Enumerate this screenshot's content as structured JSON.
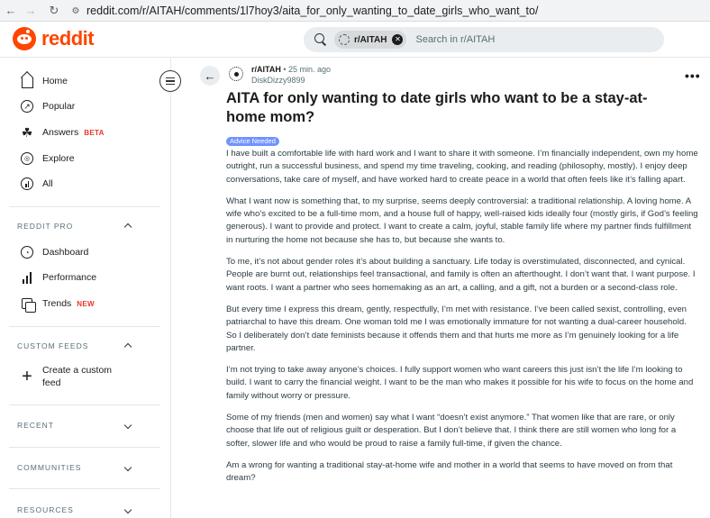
{
  "browser": {
    "url": "reddit.com/r/AITAH/comments/1l7hoy3/aita_for_only_wanting_to_date_girls_who_want_to/"
  },
  "header": {
    "logo_text": "reddit",
    "search": {
      "chip_label": "r/AITAH",
      "placeholder": "Search in r/AITAH"
    }
  },
  "sidebar": {
    "main_items": [
      {
        "label": "Home",
        "icon": "home-icon"
      },
      {
        "label": "Popular",
        "icon": "popular-icon"
      },
      {
        "label": "Answers",
        "badge": "BETA",
        "icon": "answers-icon"
      },
      {
        "label": "Explore",
        "icon": "explore-icon"
      },
      {
        "label": "All",
        "icon": "all-icon"
      }
    ],
    "reddit_pro": {
      "title": "REDDIT PRO",
      "items": [
        {
          "label": "Dashboard",
          "icon": "dashboard-icon"
        },
        {
          "label": "Performance",
          "icon": "performance-icon"
        },
        {
          "label": "Trends",
          "badge": "NEW",
          "icon": "trends-icon"
        }
      ]
    },
    "custom_feeds": {
      "title": "CUSTOM FEEDS",
      "create_label": "Create a custom feed"
    },
    "recent": {
      "title": "RECENT"
    },
    "communities": {
      "title": "COMMUNITIES"
    },
    "resources": {
      "title": "RESOURCES"
    }
  },
  "post": {
    "subreddit": "r/AITAH",
    "separator": "•",
    "time": "25 min. ago",
    "author": "DiskDizzy9899",
    "title": "AITA for only wanting to date girls who want to be a stay-at-home mom?",
    "flair": "Advice Needed",
    "paragraphs": [
      "I have built a comfortable life with hard work and I want to share it with someone. I’m financially independent, own my home outright, run a successful business, and spend my time traveling, cooking, and reading (philosophy, mostly). I enjoy deep conversations, take care of myself, and have worked hard to create peace in a world that often feels like it’s falling apart.",
      "What I want now is something that, to my surprise, seems deeply controversial: a traditional relationship. A loving home. A wife who’s excited to be a full-time mom, and a house full of happy, well-raised kids ideally four (mostly girls, if God’s feeling generous). I want to provide and protect. I want to create a calm, joyful, stable family life where my partner finds fulfillment in nurturing the home not because she has to, but because she wants to.",
      "To me, it’s not about gender roles it’s about building a sanctuary. Life today is overstimulated, disconnected, and cynical. People are burnt out, relationships feel transactional, and family is often an afterthought. I don’t want that. I want purpose. I want roots. I want a partner who sees homemaking as an art, a calling, and a gift, not a burden or a second-class role.",
      "But every time I express this dream, gently, respectfully, I’m met with resistance. I’ve been called sexist, controlling, even patriarchal to have this dream. One woman told me I was emotionally immature for not wanting a dual-career household. So I deliberately don’t date feminists because it offends them and that hurts me more as I’m genuinely looking for a life partner.",
      "I’m not trying to take away anyone’s choices. I fully support women who want careers this just isn’t the life I’m looking to build. I want to carry the financial weight. I want to be the man who makes it possible for his wife to focus on the home and family without worry or pressure.",
      "Some of my friends (men and women) say what I want “doesn’t exist anymore.” That women like that are rare, or only choose that life out of religious guilt or desperation. But I don’t believe that. I think there are still women who long for a softer, slower life and who would be proud to raise a family full-time, if given the chance.",
      "Am a wrong for wanting a traditional stay-at-home wife and mother in a world that seems to have moved on from that dream?"
    ]
  },
  "colors": {
    "brand": "#ff4500",
    "flair": "#7193ff",
    "badge_red": "#e8362c"
  }
}
